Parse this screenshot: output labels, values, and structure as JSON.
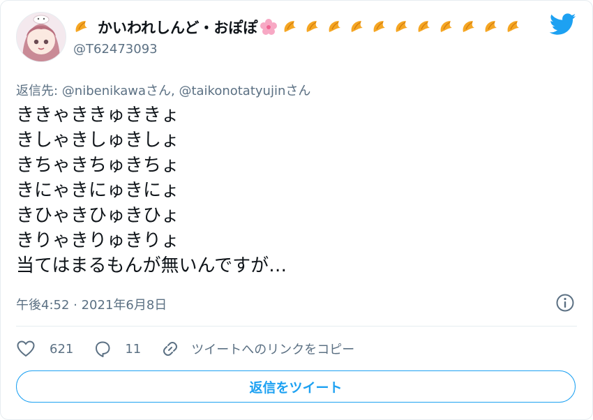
{
  "author": {
    "display_name": "かいわれしんど・おぽぽ",
    "handle": "@T62473093",
    "name_emojis_after": [
      "croissant",
      "croissant",
      "croissant",
      "croissant",
      "croissant",
      "croissant",
      "croissant",
      "croissant",
      "croissant",
      "croissant",
      "croissant"
    ],
    "name_emoji_before": "croissant",
    "name_emoji_flower": "cherry-blossom"
  },
  "reply_to": {
    "prefix": "返信先: ",
    "mentions": "@nibenikawaさん, @taikonotatyujinさん"
  },
  "tweet_lines": [
    "ききゃききゅききょ",
    "きしゃきしゅきしょ",
    "きちゃきちゅきちょ",
    "きにゃきにゅきにょ",
    "きひゃきひゅきひょ",
    "きりゃきりゅきりょ",
    "当てはまるもんが無いんですが…"
  ],
  "timestamp": "午後4:52 · 2021年6月8日",
  "actions": {
    "likes": "621",
    "comments": "11",
    "copy_link_label": "ツイートへのリンクをコピー"
  },
  "reply_button_label": "返信をツイート",
  "colors": {
    "brand_blue": "#1da1f2",
    "secondary_text": "#5b7083",
    "primary_text": "#0f1419",
    "border": "#e6ecf0"
  }
}
